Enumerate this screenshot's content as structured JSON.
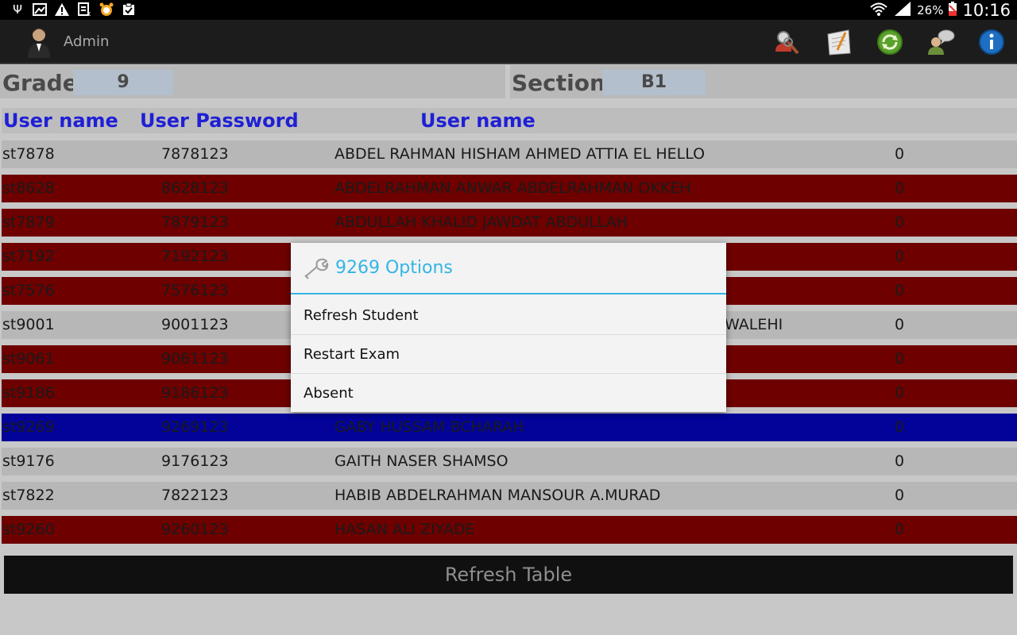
{
  "status_bar": {
    "left_icons": [
      "usb-icon",
      "image-icon",
      "warning-icon",
      "sim-icon",
      "alarm-icon",
      "clipboard-icon"
    ],
    "battery_percent": "26%",
    "time": "10:16"
  },
  "action_bar": {
    "title": "Admin",
    "buttons": [
      "search-user-icon",
      "notepad-icon",
      "refresh-icon",
      "chat-icon",
      "info-icon"
    ]
  },
  "filters": {
    "grade_label": "Grade",
    "grade_value": "9",
    "section_label": "Section",
    "section_value": "B1"
  },
  "table": {
    "headers": [
      "User name",
      "User Password",
      "User name"
    ],
    "rows": [
      {
        "user": "st7878",
        "password": "7878123",
        "name": "ABDEL RAHMAN HISHAM AHMED ATTIA EL HELLO",
        "value": "0",
        "status": "grey"
      },
      {
        "user": "st8628",
        "password": "8628123",
        "name": "ABDELRAHMAN ANWAR ABDELRAHMAN OKKEH",
        "value": "0",
        "status": "red"
      },
      {
        "user": "st7879",
        "password": "7879123",
        "name": "ABDULLAH KHALID JAWDAT ABDULLAH",
        "value": "0",
        "status": "red"
      },
      {
        "user": "st7192",
        "password": "7192123",
        "name": "",
        "value": "0",
        "status": "red"
      },
      {
        "user": "st7576",
        "password": "7576123",
        "name": "",
        "value": "0",
        "status": "red"
      },
      {
        "user": "st9001",
        "password": "9001123",
        "name": "WALEHI",
        "value": "0",
        "status": "grey"
      },
      {
        "user": "st9061",
        "password": "9061123",
        "name": "",
        "value": "0",
        "status": "red"
      },
      {
        "user": "st9186",
        "password": "9186123",
        "name": "",
        "value": "0",
        "status": "red"
      },
      {
        "user": "st9269",
        "password": "9269123",
        "name": "GABY HUSSAM BCHARAH",
        "value": "0",
        "status": "blue"
      },
      {
        "user": "st9176",
        "password": "9176123",
        "name": "GAITH NASER SHAMSO",
        "value": "0",
        "status": "grey"
      },
      {
        "user": "st7822",
        "password": "7822123",
        "name": "HABIB ABDELRAHMAN MANSOUR A.MURAD",
        "value": "0",
        "status": "grey"
      },
      {
        "user": "st9260",
        "password": "9260123",
        "name": "HASAN ALI ZIYADE",
        "value": "0",
        "status": "red"
      }
    ]
  },
  "refresh_button": "Refresh Table",
  "dialog": {
    "title": "9269 Options",
    "items": [
      "Refresh Student",
      "Restart Exam",
      "Absent"
    ]
  },
  "colors": {
    "row_grey": "#b7b7b7",
    "row_red": "#6e0000",
    "row_blue": "#03039a",
    "header_text": "#1f1fd6",
    "dialog_accent": "#33b5e5"
  }
}
